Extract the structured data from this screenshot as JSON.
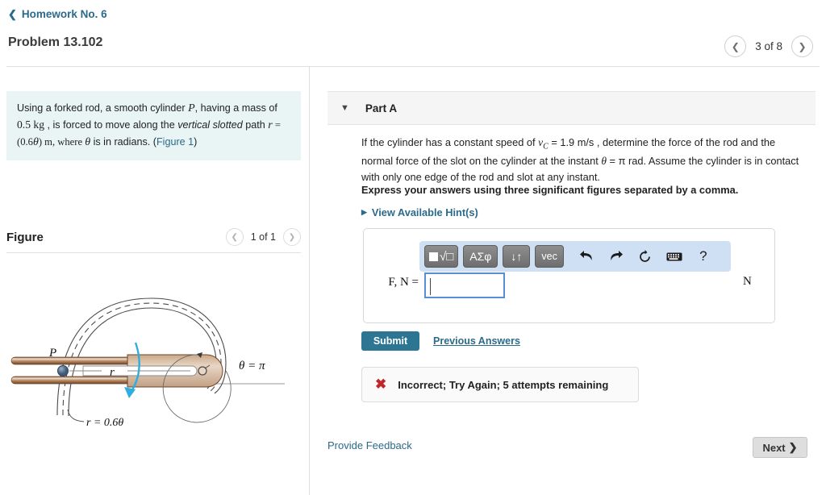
{
  "breadcrumb": {
    "back_icon": "chevron-left-icon",
    "label": "Homework No. 6"
  },
  "header": {
    "title": "Problem 13.102",
    "pager": {
      "prev_icon": "chevron-left-icon",
      "label": "3 of 8",
      "next_icon": "chevron-right-icon"
    }
  },
  "problem": {
    "text_1": "Using a forked rod, a smooth cylinder ",
    "var_P": "P",
    "text_2": ", having a mass of ",
    "mass": "0.5 kg",
    "text_3": " , is forced to move along the ",
    "emph": "vertical slotted",
    "text_4": " path ",
    "var_r": "r",
    "text_5": " = (0.6",
    "var_theta": "θ",
    "text_6": ") m, where ",
    "var_theta2": "θ",
    "text_7": " is in radians. (",
    "figure_link": "Figure 1",
    "text_8": ")"
  },
  "figure": {
    "title": "Figure",
    "pager": {
      "prev_icon": "chevron-left-icon",
      "label": "1 of 1",
      "next_icon": "chevron-right-icon"
    },
    "labels": {
      "point_P": "P",
      "radius_r": "r",
      "spiral_equation": "r = 0.6θ",
      "angle": "θ = π"
    },
    "colors": {
      "rod": "#8a5c3e",
      "rod_fill": "#d8c0aa",
      "cylinder": "#5d7b99",
      "arrow": "#2eaee0",
      "outline": "#4a4a4a"
    }
  },
  "part": {
    "collapse_icon": "triangle-down-icon",
    "title": "Part A",
    "question_1": "If the cylinder has a constant speed of ",
    "question_vc": "v",
    "question_vc_sub": "C",
    "question_2": " = 1.9 m/s , determine the force of the rod and the normal force of the slot on the cylinder at the instant ",
    "question_theta": "θ",
    "question_3": " = π rad. Assume the cylinder is in contact with only one edge of the rod and slot at any instant.",
    "express": "Express your answers using three significant figures separated by a comma.",
    "hints_icon": "triangle-right-icon",
    "hints_label": "View Available Hint(s)"
  },
  "toolbar": {
    "buttons": [
      {
        "name": "template-radical-button",
        "label": "■√□"
      },
      {
        "name": "greek-symbols-button",
        "label": "ΑΣφ"
      },
      {
        "name": "arrows-button",
        "label": "↓↑"
      },
      {
        "name": "vector-button",
        "label": "vec"
      }
    ],
    "icons": [
      {
        "name": "undo-icon",
        "glyph": "↶"
      },
      {
        "name": "redo-icon",
        "glyph": "↷"
      },
      {
        "name": "reset-icon",
        "glyph": "↻"
      },
      {
        "name": "keyboard-icon",
        "glyph": "⌨"
      },
      {
        "name": "help-icon",
        "glyph": "?"
      }
    ]
  },
  "answer": {
    "label": "F, N =",
    "value": "",
    "placeholder": "",
    "unit": "N"
  },
  "actions": {
    "submit_label": "Submit",
    "previous_answers_label": "Previous Answers"
  },
  "feedback": {
    "status_icon": "x-mark-icon",
    "message": "Incorrect; Try Again; 5 attempts remaining"
  },
  "footer": {
    "provide_feedback": "Provide Feedback",
    "next_label": "Next",
    "next_icon": "chevron-right-icon"
  },
  "colors": {
    "link": "#2b6a8a",
    "submit": "#2c7593",
    "problem_bg": "#e9f4f4",
    "toolbar_bg": "#cfe0f5",
    "error": "#c0272d"
  }
}
